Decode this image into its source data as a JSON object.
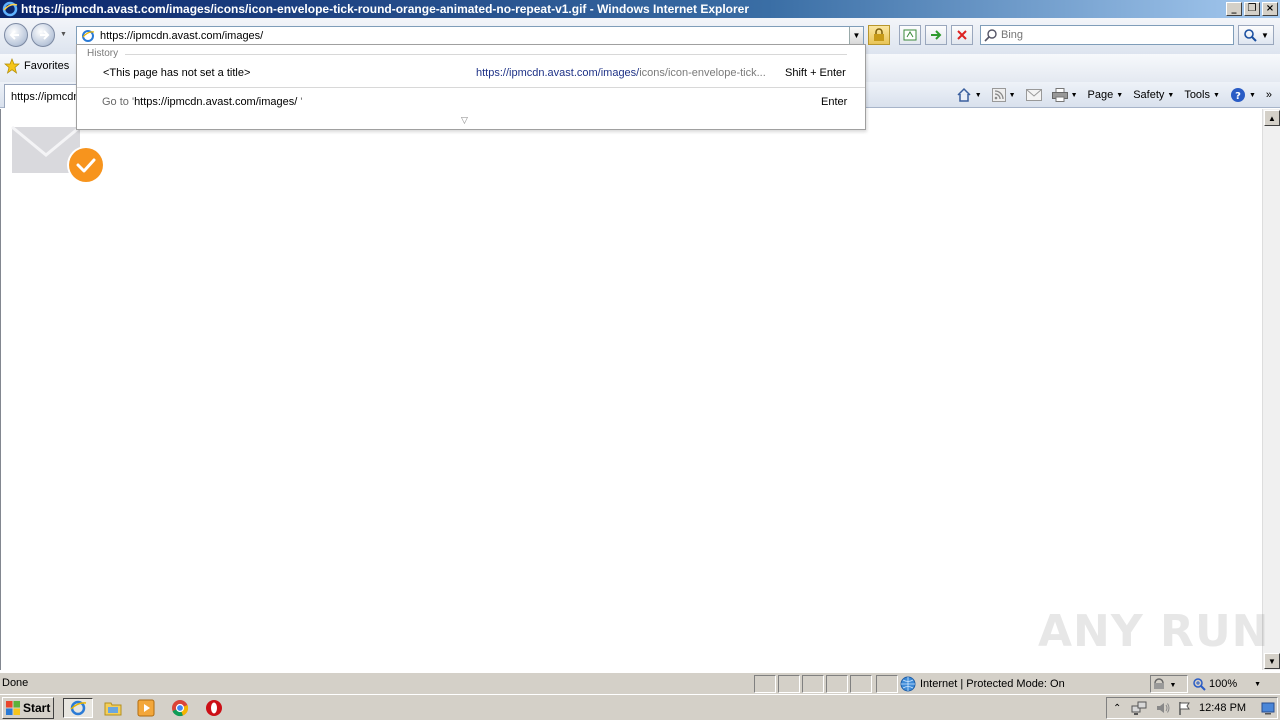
{
  "window": {
    "title": "https://ipmcdn.avast.com/images/icons/icon-envelope-tick-round-orange-animated-no-repeat-v1.gif - Windows Internet Explorer"
  },
  "address_bar": {
    "value": "https://ipmcdn.avast.com/images/"
  },
  "search": {
    "placeholder": "Bing"
  },
  "favorites": {
    "label": "Favorites"
  },
  "tab": {
    "label": "https://ipmcdn.avast.com/images/"
  },
  "command_bar": {
    "page": "Page",
    "safety": "Safety",
    "tools": "Tools"
  },
  "autocomplete": {
    "history_label": "History",
    "item": {
      "title": "<This page has not set a title>",
      "url_match": "https://ipmcdn.avast.com/images/",
      "url_rest": "icons/icon-envelope-tick...",
      "shortcut": "Shift + Enter"
    },
    "goto": {
      "prefix": "Go to '",
      "url": "https://ipmcdn.avast.com/images/",
      "suffix": " '",
      "shortcut": "Enter"
    }
  },
  "status_bar": {
    "status": "Done",
    "zone": "Internet | Protected Mode: On",
    "zoom": "100%"
  },
  "taskbar": {
    "start": "Start",
    "clock": "12:48 PM"
  },
  "watermark": "ANY RUN",
  "colors": {
    "check_badge": "#f7941d",
    "envelope": "#d9d9dd",
    "titlebar": "#0a246a"
  }
}
